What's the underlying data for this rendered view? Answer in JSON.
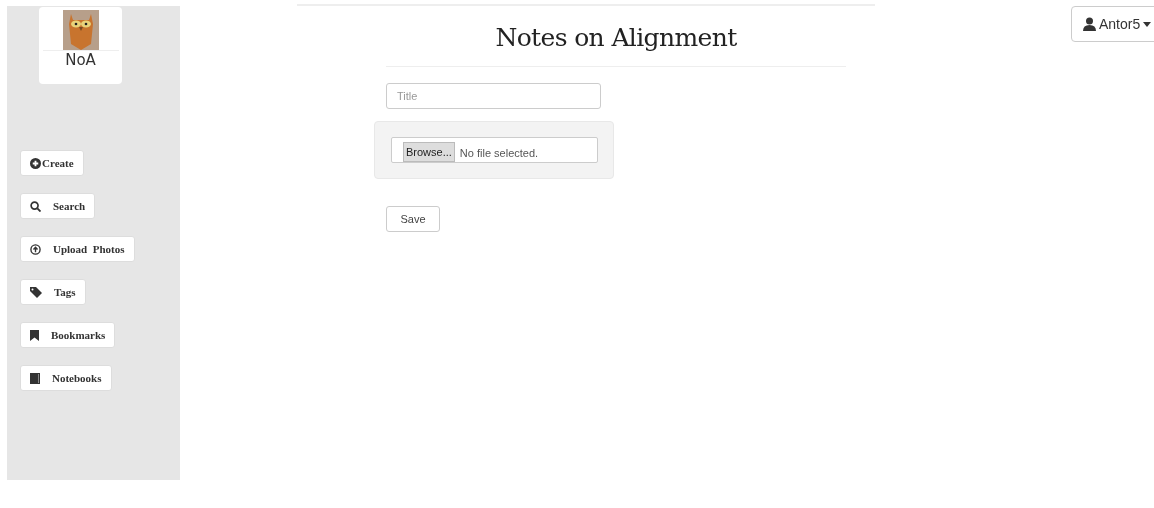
{
  "logo": {
    "text": "NoA"
  },
  "sidebar": {
    "items": [
      {
        "label": "Create"
      },
      {
        "label": "Search"
      },
      {
        "label": "Upload  Photos"
      },
      {
        "label": "Tags"
      },
      {
        "label": "Bookmarks"
      },
      {
        "label": "Notebooks"
      }
    ]
  },
  "header": {
    "title": "Notes on Alignment"
  },
  "user_menu": {
    "label": "Antor5"
  },
  "form": {
    "title_field": {
      "placeholder": "Title"
    },
    "file_input": {
      "button": "Browse...",
      "status": "No file selected."
    },
    "save_button": "Save"
  }
}
